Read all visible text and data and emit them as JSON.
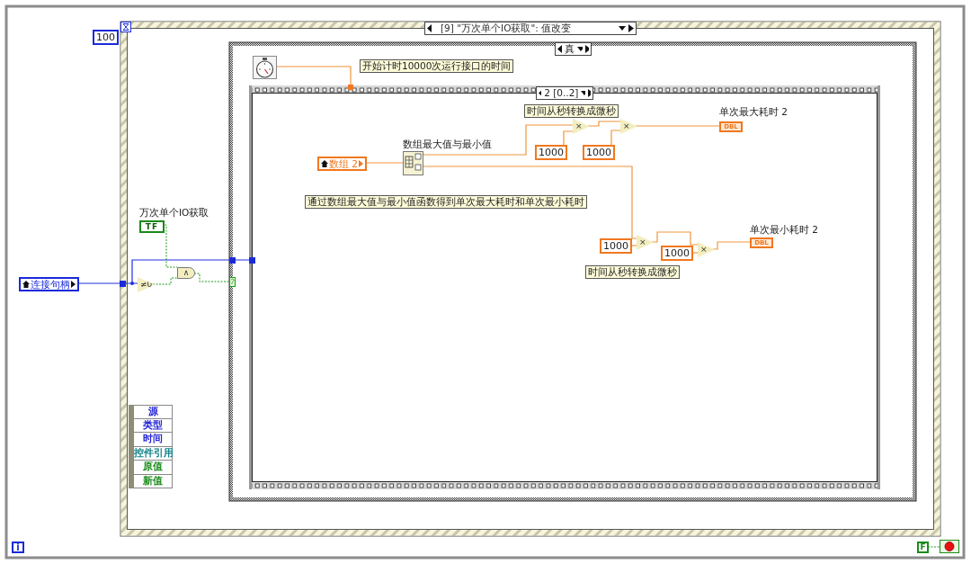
{
  "loop": {
    "iteration": "i",
    "stop_constant": "F"
  },
  "event_structure": {
    "timeout": "100",
    "selector": "[9] \"万次单个IO获取\": 值改变",
    "event_data": [
      {
        "label": "源",
        "color": "#2424d8"
      },
      {
        "label": "类型",
        "color": "#2424d8"
      },
      {
        "label": "时间",
        "color": "#2424d8"
      },
      {
        "label": "控件引用",
        "color": "#13838a"
      },
      {
        "label": "原值",
        "color": "#1a8a1a"
      },
      {
        "label": "新值",
        "color": "#1a8a1a"
      }
    ]
  },
  "outside": {
    "handle_control": "连接句柄",
    "bool_label": "万次单个IO获取",
    "bool_terminal": "TF",
    "not_equal_zero": "≠0",
    "and_gate": "∧"
  },
  "case_structure": {
    "selector": "真",
    "timer_comment": "开始计时10000次运行接口的时间"
  },
  "sequence": {
    "selector": "2 [0..2]",
    "array_control": "数组 2",
    "function_label": "数组最大值与最小值",
    "comments": [
      "时间从秒转换成微秒",
      "通过数组最大值与最小值函数得到单次最大耗时和单次最小耗时",
      "时间从秒转换成微秒"
    ],
    "constants": [
      "1000",
      "1000",
      "1000",
      "1000"
    ],
    "multiply": [
      "×",
      "×",
      "×",
      "×"
    ],
    "indicators": [
      {
        "label": "单次最大耗时 2",
        "terminal": "DBL"
      },
      {
        "label": "单次最小耗时 2",
        "terminal": "DBL"
      }
    ]
  }
}
